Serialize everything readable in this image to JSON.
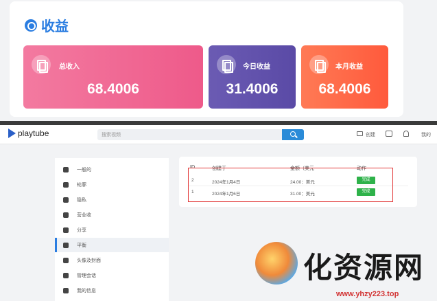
{
  "earnings": {
    "title": "收益",
    "tiles": [
      {
        "label": "总收入",
        "value": "68.4006",
        "color": "#ee5a8a"
      },
      {
        "label": "今日收益",
        "value": "31.4006",
        "color": "#5a4aa6"
      },
      {
        "label": "本月收益",
        "value": "68.4006",
        "color": "#ff5a3c"
      }
    ]
  },
  "header": {
    "brand": "playtube",
    "search_placeholder": "搜索视频",
    "upload_label": "创建",
    "user_label": "我的"
  },
  "sidebar": {
    "items": [
      {
        "label": "一般的",
        "icon": "gear-icon",
        "active": false
      },
      {
        "label": "轮廓",
        "icon": "profile-icon",
        "active": false
      },
      {
        "label": "隐私",
        "icon": "privacy-icon",
        "active": false
      },
      {
        "label": "营业收",
        "icon": "money-icon",
        "active": false
      },
      {
        "label": "分享",
        "icon": "at-icon",
        "active": false
      },
      {
        "label": "平衡",
        "icon": "wallet-icon",
        "active": true
      },
      {
        "label": "头像及封面",
        "icon": "image-icon",
        "active": false
      },
      {
        "label": "管理会话",
        "icon": "fingerprint-icon",
        "active": false
      },
      {
        "label": "我的信息",
        "icon": "info-icon",
        "active": false
      }
    ]
  },
  "withdrawals": {
    "columns": [
      "ID",
      "创建于",
      "金额（美元",
      "动作"
    ],
    "rows": [
      {
        "id": "2",
        "date": "2024年1月4日",
        "amount": "24.00：美元",
        "action": "完成"
      },
      {
        "id": "1",
        "date": "2024年1月6日",
        "amount": "31.00：美元",
        "action": "完成"
      }
    ]
  },
  "watermark": {
    "text": "化资源网",
    "url": "www.yhzy223.top"
  }
}
